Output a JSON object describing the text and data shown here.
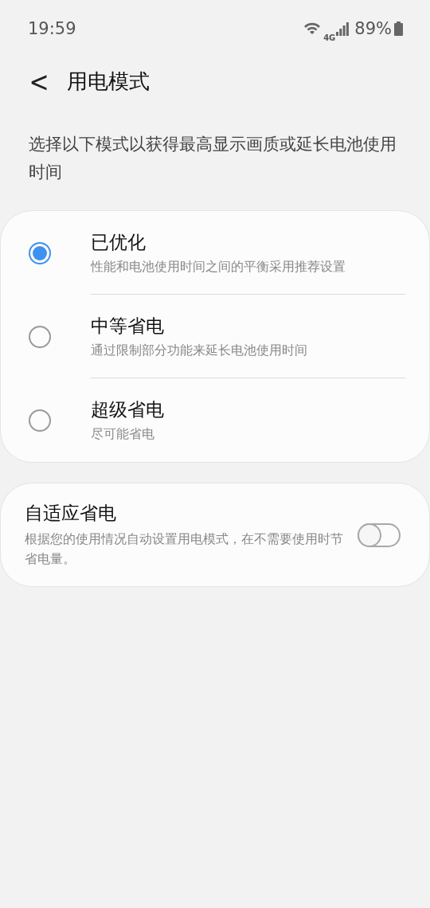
{
  "status_bar": {
    "time": "19:59",
    "network_type": "4G",
    "battery": "89%"
  },
  "header": {
    "back": "<",
    "title": "用电模式"
  },
  "description": "选择以下模式以获得最高显示画质或延长电池使用时间",
  "modes": [
    {
      "title": "已优化",
      "subtitle": "性能和电池使用时间之间的平衡采用推荐设置",
      "selected": true
    },
    {
      "title": "中等省电",
      "subtitle": "通过限制部分功能来延长电池使用时间",
      "selected": false
    },
    {
      "title": "超级省电",
      "subtitle": "尽可能省电",
      "selected": false
    }
  ],
  "adaptive": {
    "title": "自适应省电",
    "description": "根据您的使用情况自动设置用电模式，在不需要使用时节省电量。",
    "on": false
  }
}
